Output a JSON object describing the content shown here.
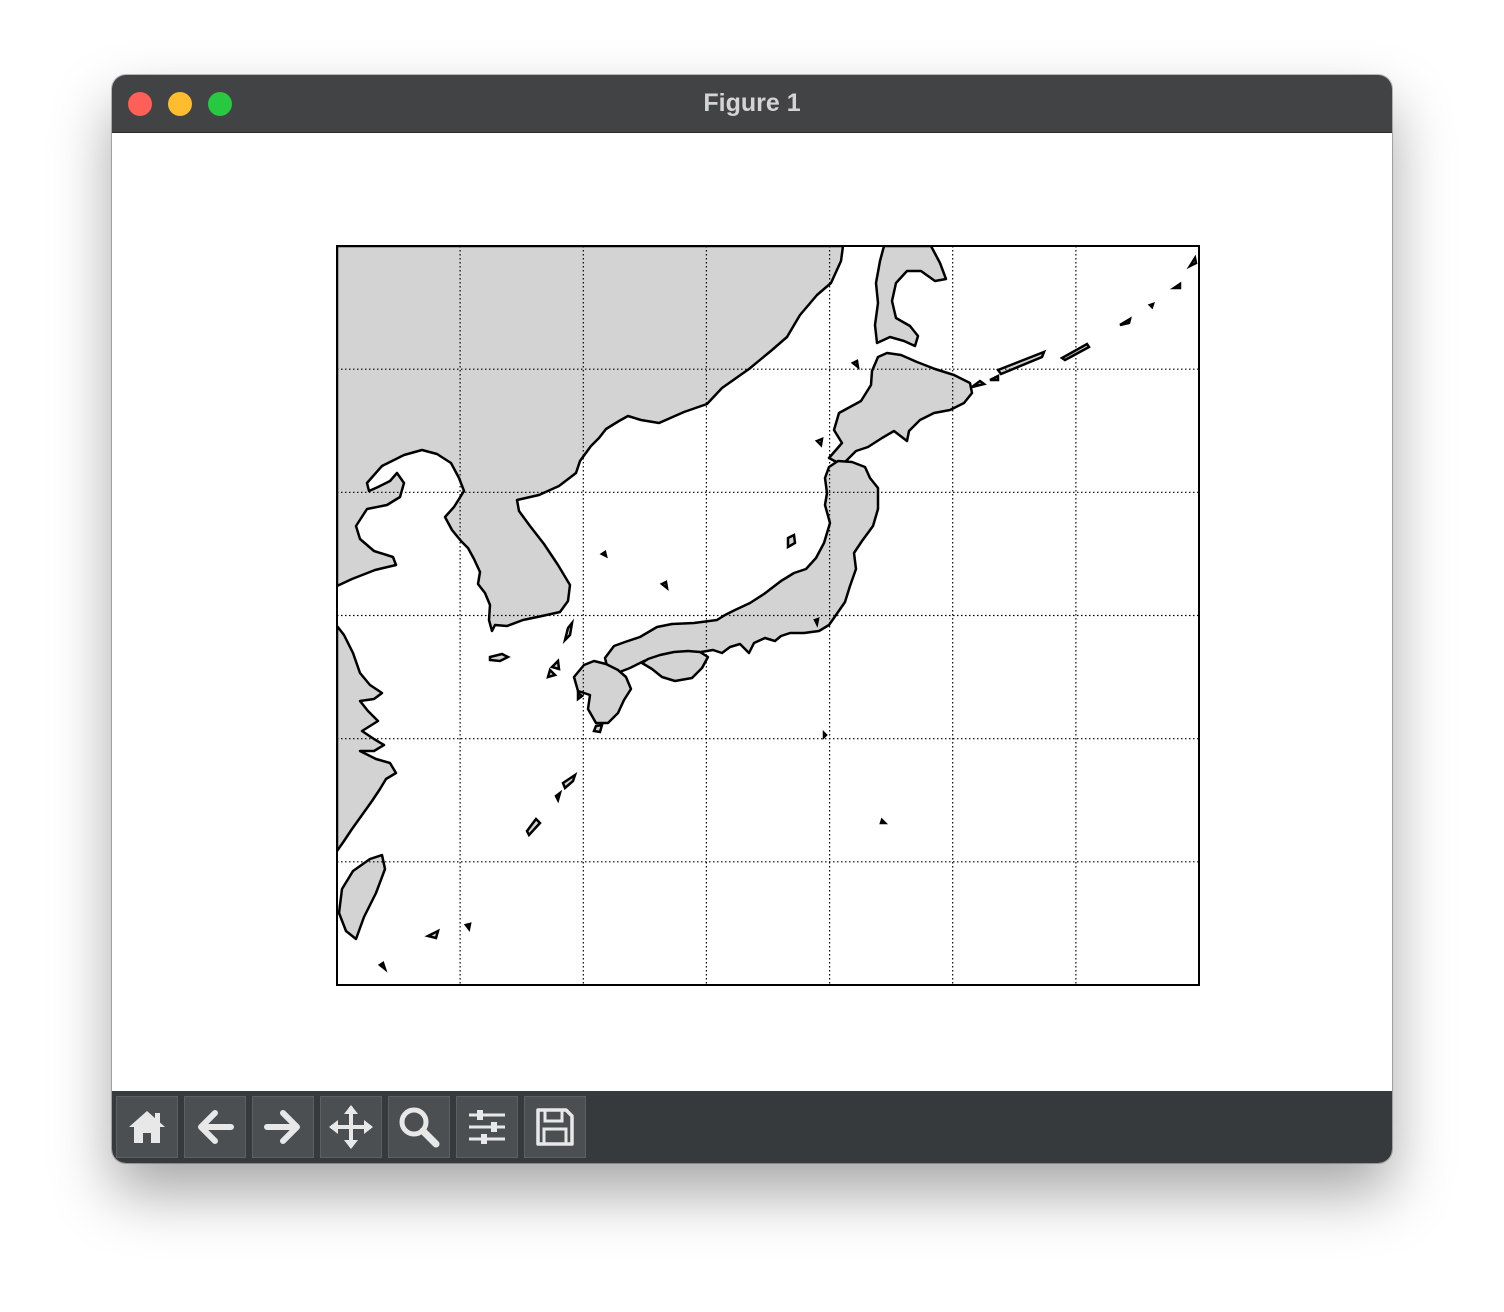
{
  "window": {
    "title": "Figure 1"
  },
  "toolbar": {
    "items": [
      {
        "name": "home-button",
        "icon": "home-icon"
      },
      {
        "name": "back-button",
        "icon": "arrow-left-icon"
      },
      {
        "name": "forward-button",
        "icon": "arrow-right-icon"
      },
      {
        "name": "pan-button",
        "icon": "move-icon"
      },
      {
        "name": "zoom-button",
        "icon": "magnifier-icon"
      },
      {
        "name": "configure-subplots-button",
        "icon": "sliders-icon"
      },
      {
        "name": "save-button",
        "icon": "floppy-disk-icon"
      }
    ]
  },
  "map": {
    "projection": "cylindrical",
    "extent": {
      "lon_min": 120,
      "lon_max": 155,
      "lat_min": 20,
      "lat_max": 50
    },
    "parallels": [
      25,
      30,
      35,
      40,
      45
    ],
    "meridians": [
      125,
      130,
      135,
      140,
      145,
      150
    ],
    "gridlines": "dotted",
    "land_color": "#d3d3d3",
    "ocean_color": "#ffffff",
    "coastline_color": "#000000"
  }
}
